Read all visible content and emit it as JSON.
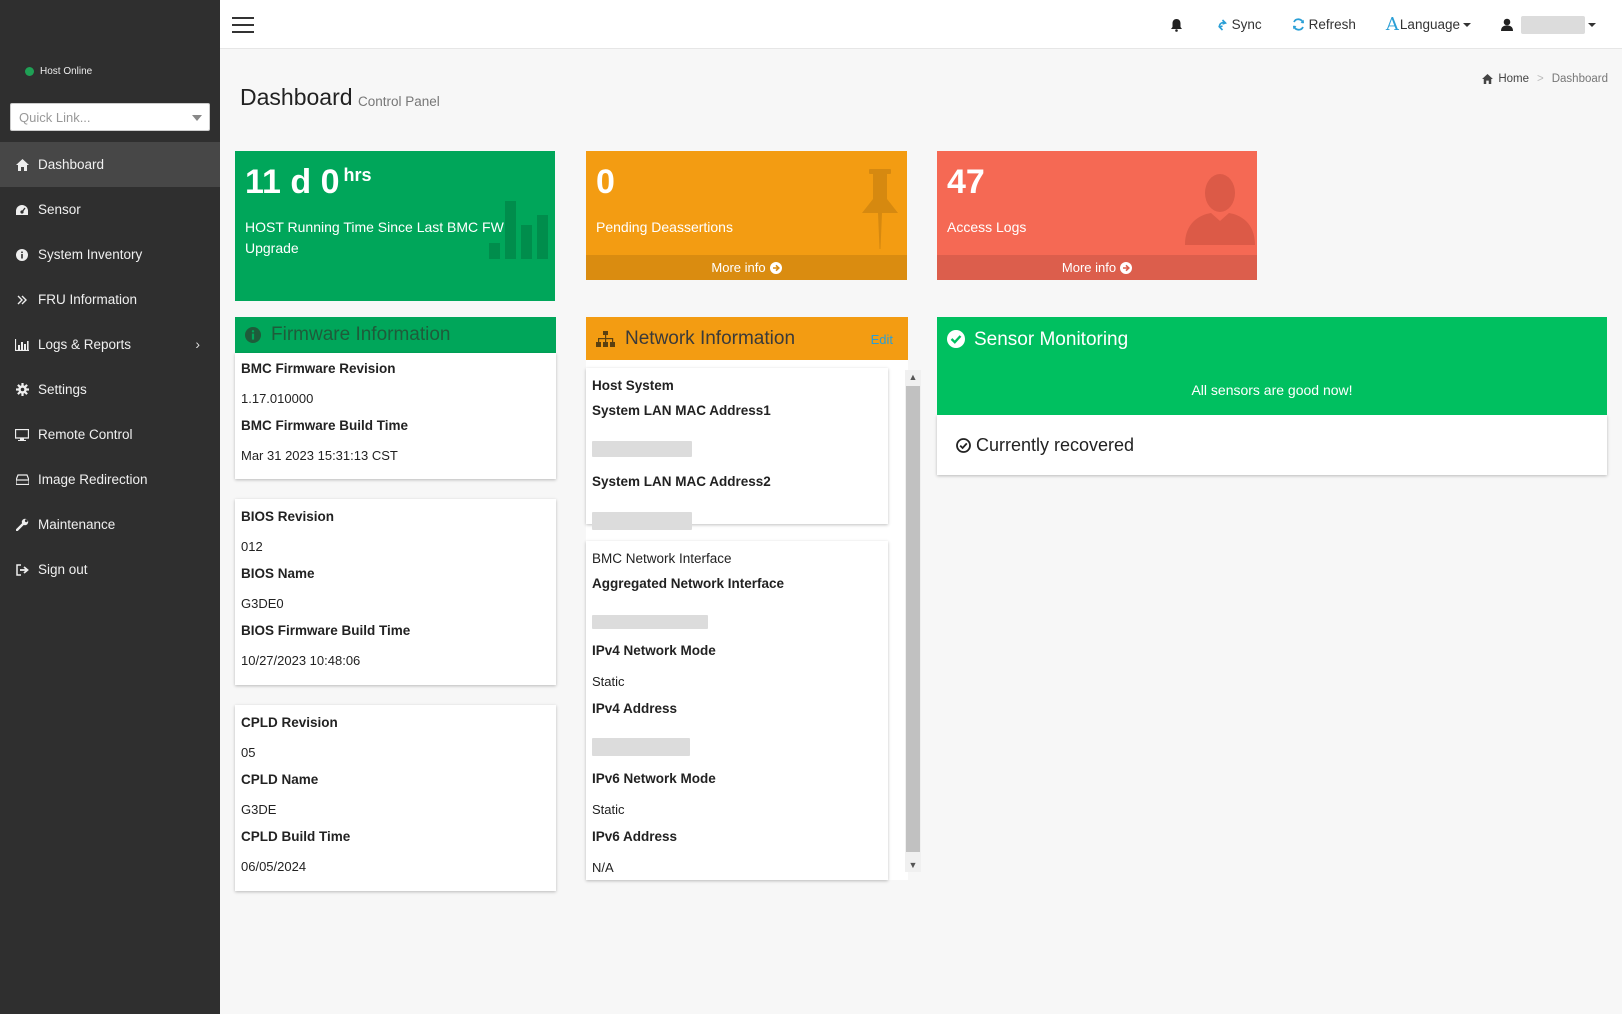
{
  "sidebar": {
    "host_status": "Host Online",
    "quicklink_placeholder": "Quick Link...",
    "items": [
      {
        "label": "Dashboard",
        "icon": "home-icon"
      },
      {
        "label": "Sensor",
        "icon": "dashboard-gauge-icon"
      },
      {
        "label": "System Inventory",
        "icon": "info-circle-icon"
      },
      {
        "label": "FRU Information",
        "icon": "double-chevron-icon"
      },
      {
        "label": "Logs & Reports",
        "icon": "bar-chart-icon"
      },
      {
        "label": "Settings",
        "icon": "gear-icon"
      },
      {
        "label": "Remote Control",
        "icon": "monitor-icon"
      },
      {
        "label": "Image Redirection",
        "icon": "drive-icon"
      },
      {
        "label": "Maintenance",
        "icon": "wrench-icon"
      },
      {
        "label": "Sign out",
        "icon": "sign-out-icon"
      }
    ]
  },
  "topbar": {
    "sync_label": "Sync",
    "refresh_label": "Refresh",
    "language_label": "Language"
  },
  "header": {
    "title": "Dashboard",
    "subtitle": "Control Panel",
    "breadcrumb_home": "Home",
    "breadcrumb_current": "Dashboard"
  },
  "boxes": {
    "uptime": {
      "value": "11 d 0",
      "unit": "hrs",
      "label": "HOST Running Time Since Last BMC FW Upgrade",
      "color": "#00a65a"
    },
    "deassert": {
      "value": "0",
      "label": "Pending Deassertions",
      "more": "More info",
      "color": "#f39c12"
    },
    "access": {
      "value": "47",
      "label": "Access Logs",
      "more": "More info",
      "color": "#f56954"
    }
  },
  "firmware": {
    "title": "Firmware Information",
    "bmc_rev_key": "BMC Firmware Revision",
    "bmc_rev_val": "1.17.010000",
    "bmc_build_key": "BMC Firmware Build Time",
    "bmc_build_val": "Mar 31 2023 15:31:13 CST",
    "bios_rev_key": "BIOS Revision",
    "bios_rev_val": "012",
    "bios_name_key": "BIOS Name",
    "bios_name_val": "G3DE0",
    "bios_build_key": "BIOS Firmware Build Time",
    "bios_build_val": "10/27/2023 10:48:06",
    "cpld_rev_key": "CPLD Revision",
    "cpld_rev_val": "05",
    "cpld_name_key": "CPLD Name",
    "cpld_name_val": "G3DE",
    "cpld_build_key": "CPLD Build Time",
    "cpld_build_val": "06/05/2024"
  },
  "network": {
    "title": "Network Information",
    "edit": "Edit",
    "host_system": "Host System",
    "mac1": "System LAN MAC Address1",
    "mac2": "System LAN MAC Address2",
    "bmc_iface": "BMC Network Interface",
    "agg_iface": "Aggregated Network Interface",
    "ipv4_mode_key": "IPv4 Network Mode",
    "ipv4_mode_val": "Static",
    "ipv4_addr_key": "IPv4 Address",
    "ipv6_mode_key": "IPv6 Network Mode",
    "ipv6_mode_val": "Static",
    "ipv6_addr_key": "IPv6 Address",
    "ipv6_addr_val": "N/A"
  },
  "sensors": {
    "title": "Sensor Monitoring",
    "status": "All sensors are good now!",
    "recovered": "Currently recovered",
    "color": "#00c060"
  }
}
